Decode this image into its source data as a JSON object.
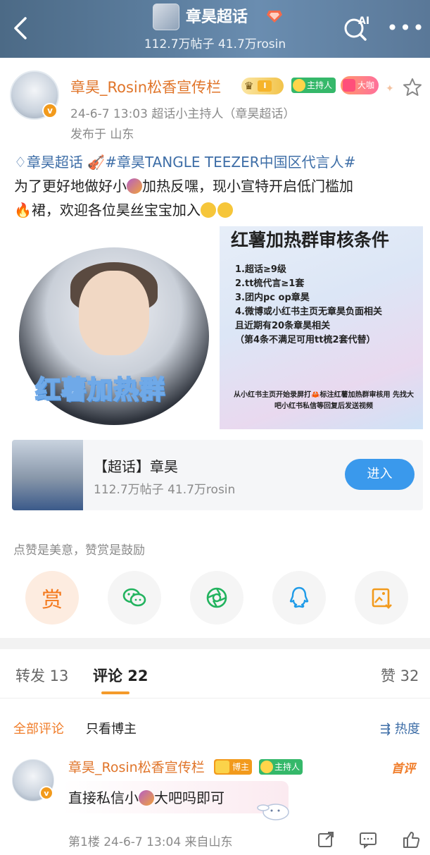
{
  "header": {
    "title": "章昊超话",
    "stats": "112.7万帖子 41.7万rosin",
    "ai_label": "AI"
  },
  "post": {
    "author": "章昊_Rosin松香宣传栏",
    "level": "I",
    "tag_host": "主持人",
    "tag_big": "大咖",
    "meta": "24-6-7 13:03  超话小主持人（章昊超话）",
    "location": "发布于 山东",
    "topic_link": "章昊超话",
    "hashtag": "#章昊TANGLE TEEZER中国区代言人#",
    "text_a": "为了更好地做好小",
    "text_b": "加热反嘿，现小宣特开启低门槛加",
    "text_c": "裙，欢迎各位昊丝宝宝加入"
  },
  "image_left": {
    "label": "红薯加热群"
  },
  "image_right": {
    "title": "红薯加热群审核条件",
    "rules": "1.超话≥9级\n2.tt梳代言≥1套\n3.团内pc op章昊\n4.微博或小红书主页无章昊负面相关\n且近期有20条章昊相关\n（第4条不满足可用tt梳2套代替）",
    "footer": "从小红书主页开始录屏打🦀标注红薯加热群审核用 先找大吧小红书私信等回复后发送视频"
  },
  "topic_card": {
    "name": "【超话】章昊",
    "stats": "112.7万帖子 41.7万rosin",
    "enter": "进入"
  },
  "reward": {
    "tip": "点赞是美意，赞赏是鼓励",
    "reward_label": "赏"
  },
  "tabs": {
    "repost": "转发 13",
    "comment": "评论 22",
    "like": "赞 32"
  },
  "filters": {
    "all": "全部评论",
    "poster_only": "只看博主",
    "sort": "热度"
  },
  "comment": {
    "author": "章昊_Rosin松香宣传栏",
    "owner_tag": "博主",
    "host_tag": "主持人",
    "top_label": "首评",
    "text_a": "直接私信小",
    "text_b": "大吧吗即可",
    "footer": "第1楼  24-6-7 13:04  来自山东"
  },
  "colors": {
    "header_bg": "#5d7fa0",
    "name_orange": "#e0752a",
    "link_blue": "#3e6ea7",
    "enter_blue": "#3a99ec",
    "accent_orange": "#f07d2a"
  },
  "icons": [
    "back-icon",
    "ai-search-icon",
    "more-icon",
    "star-icon",
    "wechat-icon",
    "moments-icon",
    "qq-icon",
    "save-image-icon",
    "repost-icon",
    "comment-icon",
    "like-icon"
  ]
}
